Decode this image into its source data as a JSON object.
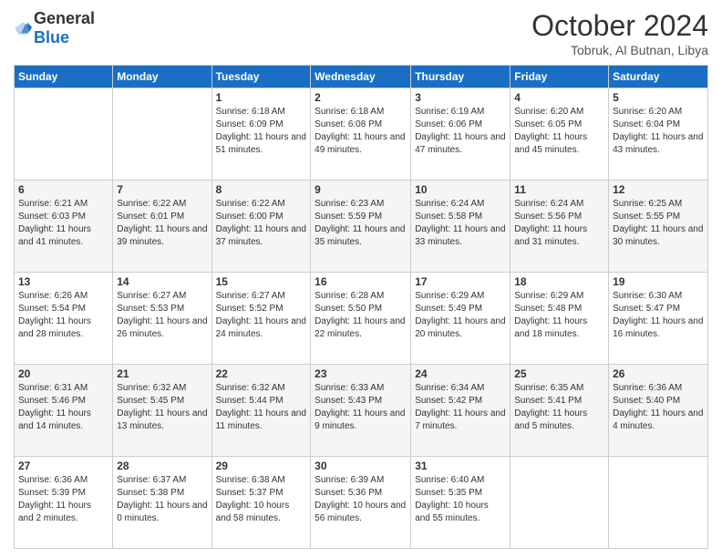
{
  "logo": {
    "text_general": "General",
    "text_blue": "Blue"
  },
  "header": {
    "month": "October 2024",
    "location": "Tobruk, Al Butnan, Libya"
  },
  "days_of_week": [
    "Sunday",
    "Monday",
    "Tuesday",
    "Wednesday",
    "Thursday",
    "Friday",
    "Saturday"
  ],
  "weeks": [
    [
      {
        "day": "",
        "info": ""
      },
      {
        "day": "",
        "info": ""
      },
      {
        "day": "1",
        "info": "Sunrise: 6:18 AM\nSunset: 6:09 PM\nDaylight: 11 hours and 51 minutes."
      },
      {
        "day": "2",
        "info": "Sunrise: 6:18 AM\nSunset: 6:08 PM\nDaylight: 11 hours and 49 minutes."
      },
      {
        "day": "3",
        "info": "Sunrise: 6:19 AM\nSunset: 6:06 PM\nDaylight: 11 hours and 47 minutes."
      },
      {
        "day": "4",
        "info": "Sunrise: 6:20 AM\nSunset: 6:05 PM\nDaylight: 11 hours and 45 minutes."
      },
      {
        "day": "5",
        "info": "Sunrise: 6:20 AM\nSunset: 6:04 PM\nDaylight: 11 hours and 43 minutes."
      }
    ],
    [
      {
        "day": "6",
        "info": "Sunrise: 6:21 AM\nSunset: 6:03 PM\nDaylight: 11 hours and 41 minutes."
      },
      {
        "day": "7",
        "info": "Sunrise: 6:22 AM\nSunset: 6:01 PM\nDaylight: 11 hours and 39 minutes."
      },
      {
        "day": "8",
        "info": "Sunrise: 6:22 AM\nSunset: 6:00 PM\nDaylight: 11 hours and 37 minutes."
      },
      {
        "day": "9",
        "info": "Sunrise: 6:23 AM\nSunset: 5:59 PM\nDaylight: 11 hours and 35 minutes."
      },
      {
        "day": "10",
        "info": "Sunrise: 6:24 AM\nSunset: 5:58 PM\nDaylight: 11 hours and 33 minutes."
      },
      {
        "day": "11",
        "info": "Sunrise: 6:24 AM\nSunset: 5:56 PM\nDaylight: 11 hours and 31 minutes."
      },
      {
        "day": "12",
        "info": "Sunrise: 6:25 AM\nSunset: 5:55 PM\nDaylight: 11 hours and 30 minutes."
      }
    ],
    [
      {
        "day": "13",
        "info": "Sunrise: 6:26 AM\nSunset: 5:54 PM\nDaylight: 11 hours and 28 minutes."
      },
      {
        "day": "14",
        "info": "Sunrise: 6:27 AM\nSunset: 5:53 PM\nDaylight: 11 hours and 26 minutes."
      },
      {
        "day": "15",
        "info": "Sunrise: 6:27 AM\nSunset: 5:52 PM\nDaylight: 11 hours and 24 minutes."
      },
      {
        "day": "16",
        "info": "Sunrise: 6:28 AM\nSunset: 5:50 PM\nDaylight: 11 hours and 22 minutes."
      },
      {
        "day": "17",
        "info": "Sunrise: 6:29 AM\nSunset: 5:49 PM\nDaylight: 11 hours and 20 minutes."
      },
      {
        "day": "18",
        "info": "Sunrise: 6:29 AM\nSunset: 5:48 PM\nDaylight: 11 hours and 18 minutes."
      },
      {
        "day": "19",
        "info": "Sunrise: 6:30 AM\nSunset: 5:47 PM\nDaylight: 11 hours and 16 minutes."
      }
    ],
    [
      {
        "day": "20",
        "info": "Sunrise: 6:31 AM\nSunset: 5:46 PM\nDaylight: 11 hours and 14 minutes."
      },
      {
        "day": "21",
        "info": "Sunrise: 6:32 AM\nSunset: 5:45 PM\nDaylight: 11 hours and 13 minutes."
      },
      {
        "day": "22",
        "info": "Sunrise: 6:32 AM\nSunset: 5:44 PM\nDaylight: 11 hours and 11 minutes."
      },
      {
        "day": "23",
        "info": "Sunrise: 6:33 AM\nSunset: 5:43 PM\nDaylight: 11 hours and 9 minutes."
      },
      {
        "day": "24",
        "info": "Sunrise: 6:34 AM\nSunset: 5:42 PM\nDaylight: 11 hours and 7 minutes."
      },
      {
        "day": "25",
        "info": "Sunrise: 6:35 AM\nSunset: 5:41 PM\nDaylight: 11 hours and 5 minutes."
      },
      {
        "day": "26",
        "info": "Sunrise: 6:36 AM\nSunset: 5:40 PM\nDaylight: 11 hours and 4 minutes."
      }
    ],
    [
      {
        "day": "27",
        "info": "Sunrise: 6:36 AM\nSunset: 5:39 PM\nDaylight: 11 hours and 2 minutes."
      },
      {
        "day": "28",
        "info": "Sunrise: 6:37 AM\nSunset: 5:38 PM\nDaylight: 11 hours and 0 minutes."
      },
      {
        "day": "29",
        "info": "Sunrise: 6:38 AM\nSunset: 5:37 PM\nDaylight: 10 hours and 58 minutes."
      },
      {
        "day": "30",
        "info": "Sunrise: 6:39 AM\nSunset: 5:36 PM\nDaylight: 10 hours and 56 minutes."
      },
      {
        "day": "31",
        "info": "Sunrise: 6:40 AM\nSunset: 5:35 PM\nDaylight: 10 hours and 55 minutes."
      },
      {
        "day": "",
        "info": ""
      },
      {
        "day": "",
        "info": ""
      }
    ]
  ]
}
